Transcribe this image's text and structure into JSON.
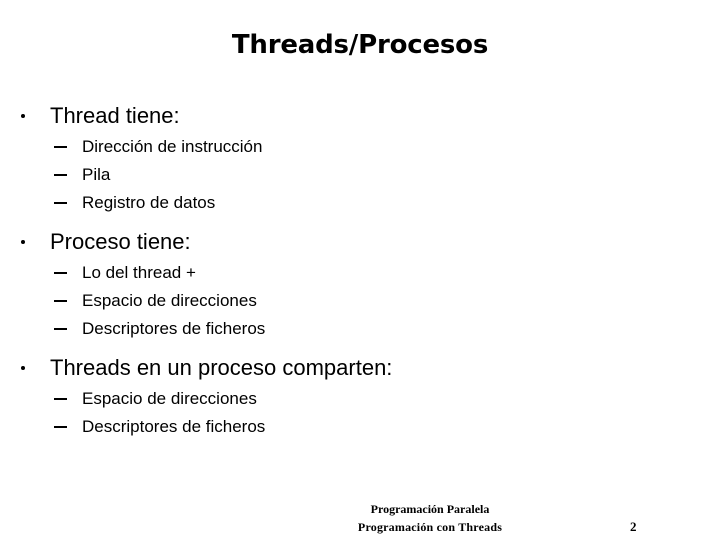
{
  "slide": {
    "title": "Threads/Procesos",
    "groups": [
      {
        "heading": "Thread tiene:",
        "items": [
          "Dirección de instrucción",
          "Pila",
          "Registro de datos"
        ]
      },
      {
        "heading": "Proceso tiene:",
        "items": [
          "Lo del thread +",
          "Espacio de direcciones",
          "Descriptores de ficheros"
        ]
      },
      {
        "heading": "Threads en un proceso comparten:",
        "items": [
          "Espacio de direcciones",
          "Descriptores de ficheros"
        ]
      }
    ],
    "footer": {
      "line1": "Programación Paralela",
      "line2": "Programación con Threads",
      "page_number": "2"
    },
    "colors": {
      "background": "#ffffff",
      "text": "#000000"
    }
  }
}
